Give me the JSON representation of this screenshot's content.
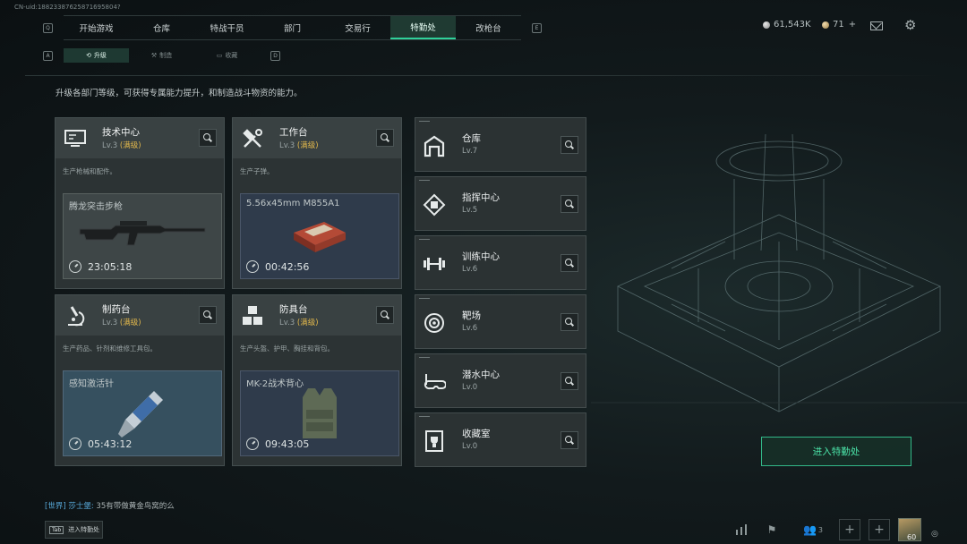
{
  "uid_text": "CN-uid:18823387625871695804?",
  "nav": {
    "key_left": "Q",
    "key_right": "E",
    "tabs": [
      {
        "label": "开始游戏",
        "active": false
      },
      {
        "label": "仓库",
        "active": false
      },
      {
        "label": "特战干员",
        "active": false
      },
      {
        "label": "部门",
        "active": false
      },
      {
        "label": "交易行",
        "active": false
      },
      {
        "label": "特勤处",
        "active": true
      },
      {
        "label": "改枪台",
        "active": false
      }
    ]
  },
  "currency": {
    "silver": "61,543K",
    "gold": "71",
    "gold_plus": "+"
  },
  "subnav": {
    "key_left": "A",
    "key_right": "D",
    "tabs": [
      {
        "label": "升级",
        "active": true
      },
      {
        "label": "制造",
        "active": false
      },
      {
        "label": "收藏",
        "active": false
      }
    ]
  },
  "description": "升级各部门等级，可获得专属能力提升，和制造战斗物资的能力。",
  "level_max": "(满级)",
  "cards": [
    {
      "title": "技术中心",
      "level": "Lv.3",
      "subtitle": "生产枪械和配件。",
      "product": "腾龙突击步枪",
      "timer": "23:05:18",
      "icon": "monitor-icon",
      "product_icon": "rifle-icon"
    },
    {
      "title": "工作台",
      "level": "Lv.3",
      "subtitle": "生产子弹。",
      "product": "5.56x45mm M855A1",
      "timer": "00:42:56",
      "icon": "tools-icon",
      "product_icon": "ammo-box-icon"
    },
    {
      "title": "制药台",
      "level": "Lv.3",
      "subtitle": "生产药品、针剂和维修工具包。",
      "product": "感知激活针",
      "timer": "05:43:12",
      "icon": "microscope-icon",
      "product_icon": "syringe-icon"
    },
    {
      "title": "防具台",
      "level": "Lv.3",
      "subtitle": "生产头盔、护甲、胸挂和背包。",
      "product": "MK-2战术背心",
      "timer": "09:43:05",
      "icon": "armor-cubes-icon",
      "product_icon": "vest-icon"
    }
  ],
  "departments": [
    {
      "title": "仓库",
      "level": "Lv.7",
      "icon": "warehouse-icon"
    },
    {
      "title": "指挥中心",
      "level": "Lv.5",
      "icon": "command-chip-icon"
    },
    {
      "title": "训练中心",
      "level": "Lv.6",
      "icon": "dumbbell-icon"
    },
    {
      "title": "靶场",
      "level": "Lv.6",
      "icon": "target-icon"
    },
    {
      "title": "潜水中心",
      "level": "Lv.0",
      "icon": "diving-mask-icon"
    },
    {
      "title": "收藏室",
      "level": "Lv.0",
      "icon": "trophy-case-icon"
    }
  ],
  "enter_button": "进入特勤处",
  "chat": {
    "channel": "[世界]",
    "user": "莎士堡:",
    "message": "35有带做黄金鸟窝的么"
  },
  "bottom_hint": {
    "key": "Tab",
    "label": "进入特勤处"
  },
  "bottom_bar": {
    "friends_count": "3",
    "avatar_count": "60"
  },
  "colors": {
    "accent_green": "#2fd19a",
    "max_level_gold": "#e2b84c",
    "chat_blue": "#58a9d9"
  }
}
